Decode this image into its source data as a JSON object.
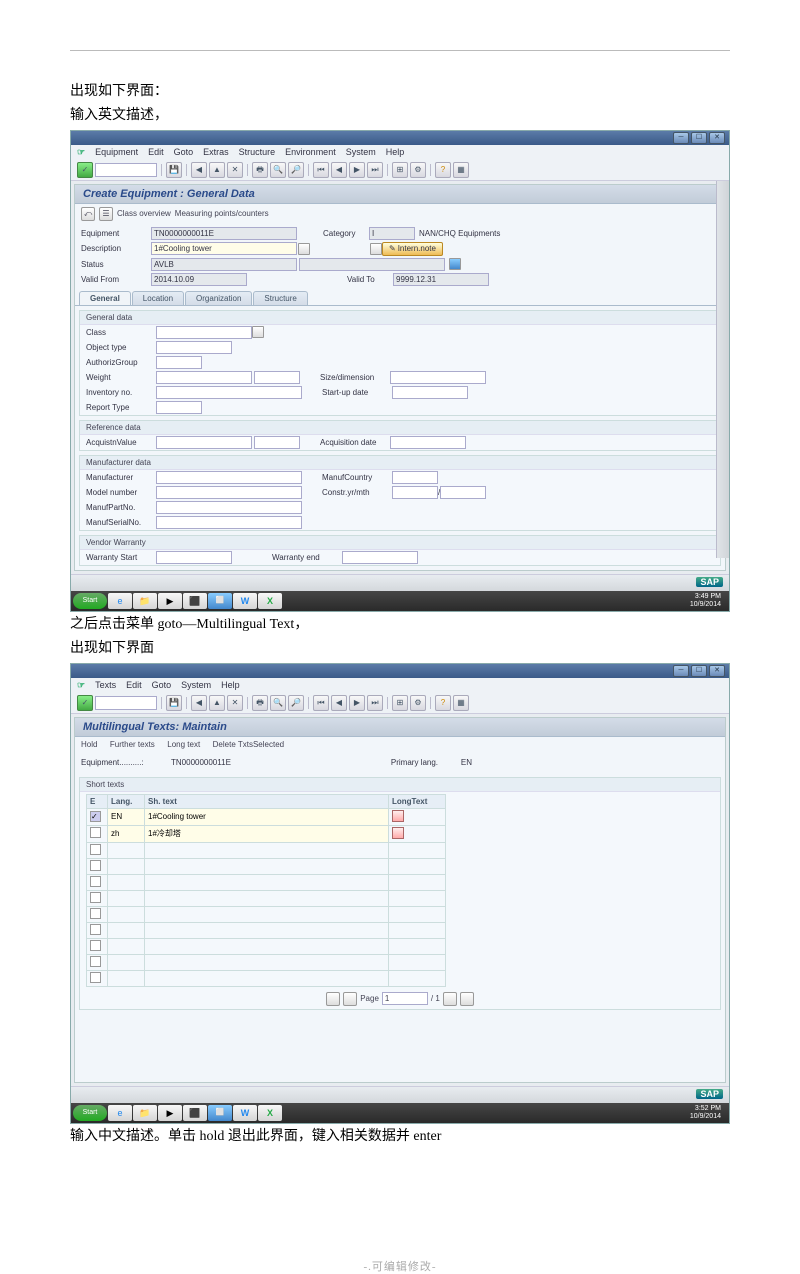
{
  "doc": {
    "line1": "出现如下界面：",
    "line2": "输入英文描述，",
    "line3": "之后点击菜单 goto—Multilingual Text，",
    "line4": "出现如下界面",
    "line5": "输入中文描述。单击 hold 退出此界面，键入相关数据并 enter",
    "footer": "-.可编辑修改-"
  },
  "sap1": {
    "menu": [
      "☞",
      "Equipment",
      "Edit",
      "Goto",
      "Extras",
      "Structure",
      "Environment",
      "System",
      "Help"
    ],
    "title": "Create Equipment : General Data",
    "subbar": {
      "icon1": "⤺",
      "icon2": "☰",
      "btn1": "Class overview",
      "btn2": "Measuring points/counters"
    },
    "header": {
      "equip_lbl": "Equipment",
      "equip_val": "TN0000000011E",
      "cat_lbl": "Category",
      "cat_val": "I",
      "cat_desc": "NAN/CHQ Equipments",
      "desc_lbl": "Description",
      "desc_val": "1#Cooling tower",
      "note_btn": "Intern.note",
      "status_lbl": "Status",
      "status_val": "AVLB",
      "vfrom_lbl": "Valid From",
      "vfrom_val": "2014.10.09",
      "vto_lbl": "Valid To",
      "vto_val": "9999.12.31"
    },
    "tabs": [
      "General",
      "Location",
      "Organization",
      "Structure"
    ],
    "gen": {
      "head": "General data",
      "class": "Class",
      "objtype": "Object type",
      "authg": "AuthorizGroup",
      "weight": "Weight",
      "size": "Size/dimension",
      "inv": "Inventory no.",
      "startup": "Start-up date",
      "report": "Report Type"
    },
    "ref": {
      "head": "Reference data",
      "acqv": "AcquistnValue",
      "acqd": "Acquisition date"
    },
    "manu": {
      "head": "Manufacturer data",
      "manu": "Manufacturer",
      "mcountry": "ManufCountry",
      "model": "Model number",
      "constr": "Constr.yr/mth",
      "partno": "ManufPartNo.",
      "serial": "ManufSerialNo."
    },
    "vw": {
      "head": "Vendor Warranty",
      "ws": "Warranty Start",
      "we": "Warranty end"
    },
    "clock": {
      "time": "3:49 PM",
      "date": "10/9/2014"
    }
  },
  "sap2": {
    "menu": [
      "☞",
      "Texts",
      "Edit",
      "Goto",
      "System",
      "Help"
    ],
    "title": "Multilingual Texts: Maintain",
    "subbar": {
      "b1": "Hold",
      "b2": "Further texts",
      "b3": "Long text",
      "b4": "Delete TxtsSelected"
    },
    "header": {
      "equip_lbl": "Equipment..........:",
      "equip_val": "TN0000000011E",
      "plang_lbl": "Primary lang.",
      "plang_val": "EN"
    },
    "table": {
      "head": "Short texts",
      "cols": {
        "check": "E",
        "lang": "Lang.",
        "short": "Sh. text",
        "long": "LongText"
      },
      "rows": [
        {
          "check": true,
          "lang": "EN",
          "short": "1#Cooling tower"
        },
        {
          "check": false,
          "lang": "zh",
          "short": "1#冷却塔"
        }
      ],
      "page_lbl": "Page",
      "page_cur": "1",
      "page_of": "/ 1"
    },
    "clock": {
      "time": "3:52 PM",
      "date": "10/9/2014"
    }
  },
  "taskbar": {
    "start": "Start"
  }
}
